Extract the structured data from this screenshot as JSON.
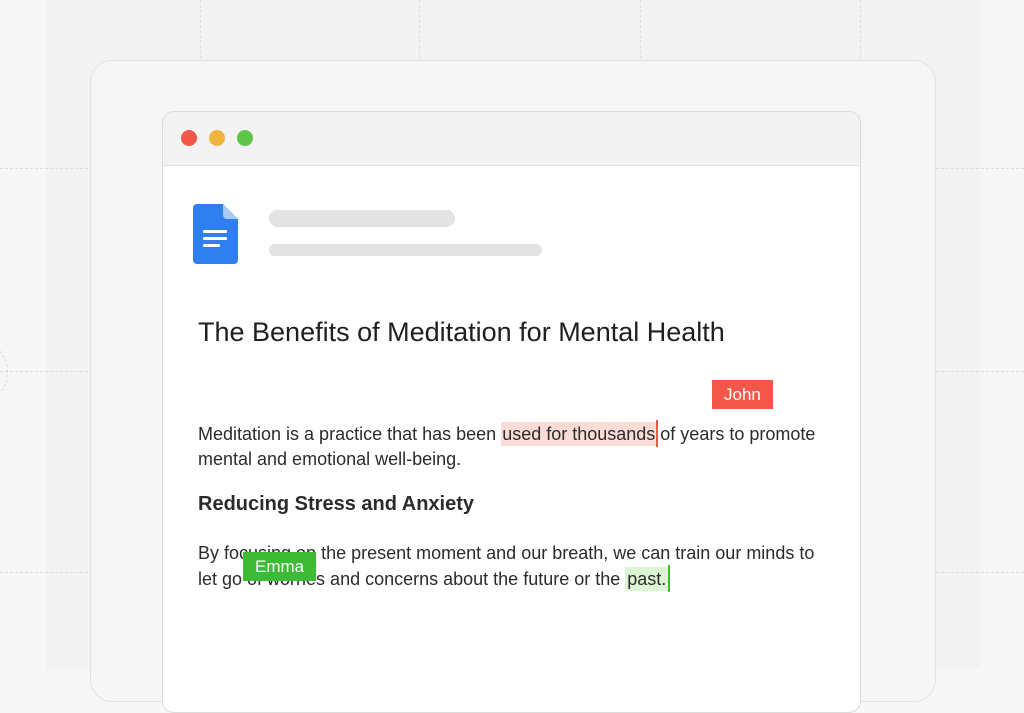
{
  "window": {
    "controls": [
      "close",
      "minimize",
      "maximize"
    ]
  },
  "document": {
    "app_icon": "google-docs-icon",
    "title": "The Benefits of Meditation for Mental Health",
    "paragraph1": {
      "before": "Meditation is a practice that has been ",
      "highlight": "used for thousands",
      "after": "of years to promote mental and emotional well-being."
    },
    "subheading": "Reducing Stress and Anxiety",
    "paragraph2": {
      "before": "By focusing on the present moment and our breath, we can train our minds to let go of worries and concerns about the future or the ",
      "highlight": "past."
    }
  },
  "collaborators": {
    "john": {
      "name": "John",
      "color": "#f2574a"
    },
    "emma": {
      "name": "Emma",
      "color": "#3dbb35"
    }
  },
  "colors": {
    "red_highlight": "#fbdcd6",
    "green_highlight": "#daf6d2",
    "doc_blue": "#2f7ff0"
  }
}
